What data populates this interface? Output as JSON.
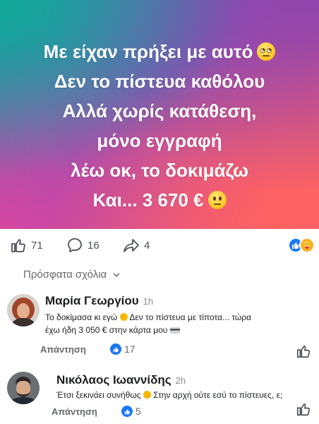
{
  "post": {
    "lines": [
      "Με είχαν πρήξει με αυτό",
      "Δεν το πίστευα καθόλου",
      "Αλλά χωρίς κατάθεση,",
      "μόνο εγγραφή",
      "λέω οκ, το δοκιμάζω",
      "Και... 3 670 €"
    ],
    "emojis": [
      "eye-roll-emoji",
      "neutral-face-emoji"
    ],
    "colors": {
      "gradient_start": "#2a8fb0",
      "gradient_mid": "#8a4fb8",
      "gradient_end": "#ff6a5a"
    }
  },
  "actions": {
    "likes": "71",
    "comments": "16",
    "shares": "4",
    "reactions": [
      "like",
      "care"
    ]
  },
  "comments_section": {
    "sort_label": "Πρόσφατα σχόλια"
  },
  "comments": [
    {
      "author": "Μαρία Γεωργίου",
      "time": "1h",
      "text_line1": "Το δοκίμασα κι εγώ",
      "text_line1_rest": "Δεν το πίστευα με τίποτα... τώρα",
      "text_line2": "έχω ήδη 3 050 € στην κάρτα μου",
      "reply_label": "Απάντηση",
      "likes": "17"
    },
    {
      "author": "Νικόλαος Ιωαννίδης",
      "time": "2h",
      "text_line1": "Έτσι ξεκινάει συνήθως",
      "text_line1_rest": "Στην αρχή ούτε εσύ το πίστευες, ε;",
      "reply_label": "Απάντηση",
      "likes": "5"
    }
  ]
}
